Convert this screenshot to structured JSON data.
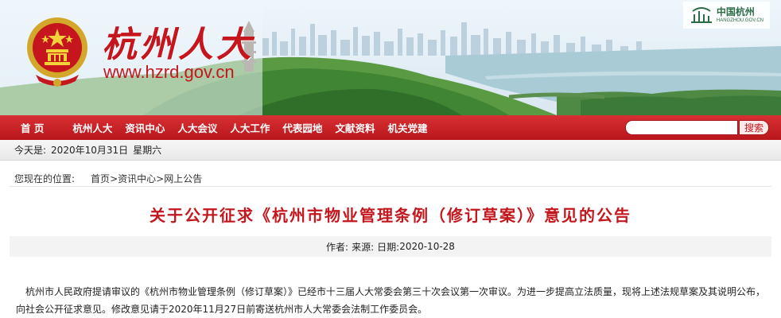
{
  "header": {
    "site_name": "杭州人大",
    "site_url": "www.hzrd.gov.cn",
    "partner_logo": {
      "name": "中国杭州",
      "subtitle": "HANGZHOU.GOV.CN"
    }
  },
  "nav": {
    "items": [
      "首 页",
      "杭州人大",
      "资讯中心",
      "人大会议",
      "人大工作",
      "代表园地",
      "文献资料",
      "机关党建"
    ],
    "search_placeholder": "",
    "search_button": "搜索"
  },
  "datebar": {
    "label": "今天是:",
    "date": "2020年10月31日",
    "weekday": "星期六"
  },
  "breadcrumb": {
    "label": "您现在的位置:",
    "items": [
      "首页",
      "资讯中心",
      "网上公告"
    ],
    "separator": ">"
  },
  "article": {
    "title": "关于公开征求《杭州市物业管理条例（修订草案）》意见的公告",
    "meta": {
      "author_label": "作者:",
      "source_label": "来源:",
      "date_label": "日期:",
      "date": "2020-10-28"
    },
    "body": "杭州市人民政府提请审议的《杭州市物业管理条例（修订草案）》已经市十三届人大常委会第三十次会议第一次审议。为进一步提高立法质量，现将上述法规草案及其说明公布，向社会公开征求意见。修改意见请于2020年11月27日前寄送杭州市人大常委会法制工作委员会。"
  },
  "colors": {
    "brand_red": "#c4161c",
    "nav_red": "#c8202a",
    "meta_bg": "#f3f3f3"
  }
}
